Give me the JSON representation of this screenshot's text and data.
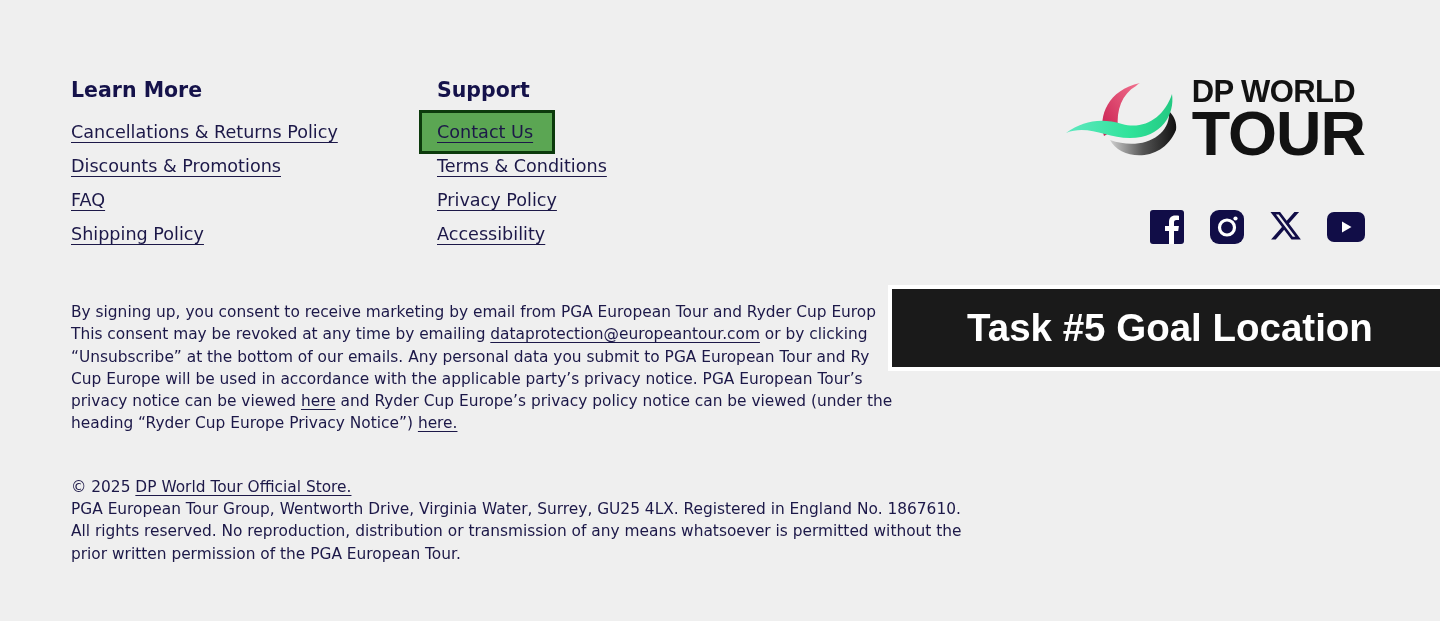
{
  "learn_more": {
    "heading": "Learn More",
    "links": [
      {
        "label": "Cancellations & Returns Policy",
        "highlighted": false
      },
      {
        "label": "Discounts & Promotions",
        "highlighted": false
      },
      {
        "label": "FAQ",
        "highlighted": false
      },
      {
        "label": "Shipping Policy",
        "highlighted": false
      }
    ]
  },
  "support": {
    "heading": "Support",
    "links": [
      {
        "label": "Contact Us",
        "highlighted": true
      },
      {
        "label": "Terms & Conditions",
        "highlighted": false
      },
      {
        "label": "Privacy Policy",
        "highlighted": false
      },
      {
        "label": "Accessibility",
        "highlighted": false
      }
    ]
  },
  "brand": {
    "logo_line_1": "DP WORLD",
    "logo_line_2": "TOUR"
  },
  "consent": {
    "lines": [
      [
        {
          "kind": "text",
          "text": "By signing up, you consent to receive marketing by email from PGA European Tour and Ryder Cup Europ"
        }
      ],
      [
        {
          "kind": "text",
          "text": "This consent may be revoked at any time by emailing"
        },
        {
          "kind": "link",
          "text": "dataprotection@europeantour.com"
        },
        {
          "kind": "text",
          "text": "or by clicking"
        }
      ],
      [
        {
          "kind": "text",
          "text": "“Unsubscribe” at the bottom of our emails. Any personal data you submit to PGA European Tour and Ry"
        }
      ],
      [
        {
          "kind": "text",
          "text": "Cup Europe will be used in accordance with the applicable party’s privacy notice. PGA European Tour’s"
        }
      ],
      [
        {
          "kind": "text",
          "text": "privacy notice can be viewed"
        },
        {
          "kind": "link",
          "text": "here"
        },
        {
          "kind": "text",
          "text": "and Ryder Cup Europe’s privacy policy notice can be viewed (under the"
        }
      ],
      [
        {
          "kind": "text",
          "text": "heading “Ryder Cup Europe Privacy Notice”)"
        },
        {
          "kind": "link",
          "text": "here."
        }
      ]
    ]
  },
  "legal": {
    "lines": [
      [
        {
          "kind": "text",
          "text": "© 2025"
        },
        {
          "kind": "link",
          "text": "DP World Tour Official Store."
        }
      ],
      [
        {
          "kind": "text",
          "text": "PGA European Tour Group, Wentworth Drive, Virginia Water, Surrey, GU25 4LX. Registered in England No. 1867610."
        }
      ],
      [
        {
          "kind": "text",
          "text": "All rights reserved. No reproduction, distribution or transmission of any means whatsoever is permitted without the"
        }
      ],
      [
        {
          "kind": "text",
          "text": "prior written permission of the PGA European Tour."
        }
      ]
    ]
  },
  "banner": {
    "text": "Task #5 Goal Location"
  }
}
